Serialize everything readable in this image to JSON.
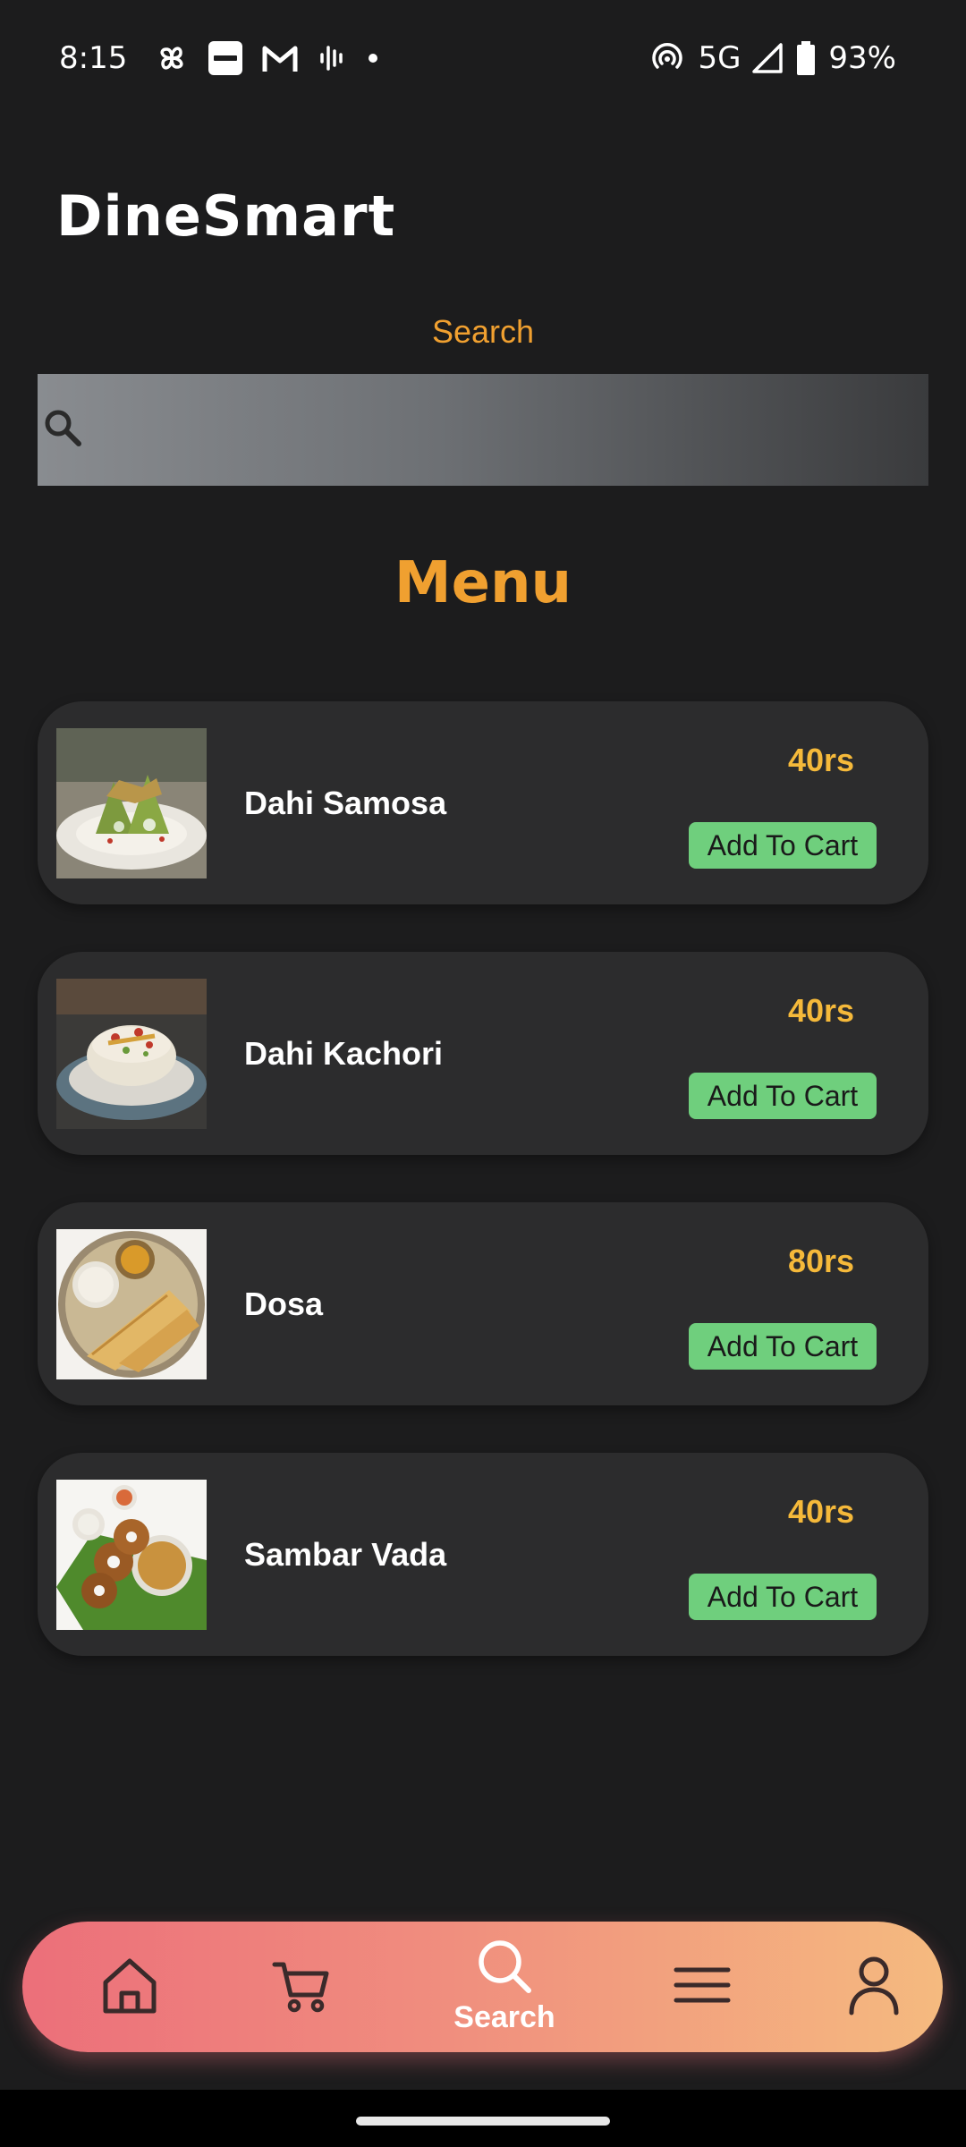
{
  "status_bar": {
    "time": "8:15",
    "network": "5G",
    "battery": "93%",
    "icons": [
      "pinwheel-icon",
      "paytm-icon",
      "gmail-icon",
      "voice-wave-icon",
      "dot-icon",
      "hotspot-icon",
      "signal-icon",
      "battery-icon"
    ]
  },
  "app": {
    "title": "DineSmart"
  },
  "search": {
    "label": "Search",
    "placeholder": "",
    "value": ""
  },
  "menu": {
    "heading": "Menu",
    "items": [
      {
        "name": "Dahi Samosa",
        "price": "40rs",
        "button_label": "Add To Cart"
      },
      {
        "name": "Dahi Kachori",
        "price": "40rs",
        "button_label": "Add To Cart"
      },
      {
        "name": "Dosa",
        "price": "80rs",
        "button_label": "Add To Cart"
      },
      {
        "name": "Sambar Vada",
        "price": "40rs",
        "button_label": "Add To Cart"
      }
    ]
  },
  "bottom_nav": {
    "items": [
      {
        "icon": "home-icon",
        "label": ""
      },
      {
        "icon": "cart-icon",
        "label": ""
      },
      {
        "icon": "search-icon",
        "label": "Search",
        "active": true
      },
      {
        "icon": "hamburger-menu-icon",
        "label": ""
      },
      {
        "icon": "profile-icon",
        "label": ""
      }
    ]
  },
  "colors": {
    "background": "#1c1c1d",
    "accent_orange": "#f0a030",
    "price_yellow": "#f5b93a",
    "card": "#2c2c2d",
    "button_green": "#6fcf7d",
    "nav_gradient_start": "#ec6f7a",
    "nav_gradient_end": "#f5ba7f"
  }
}
